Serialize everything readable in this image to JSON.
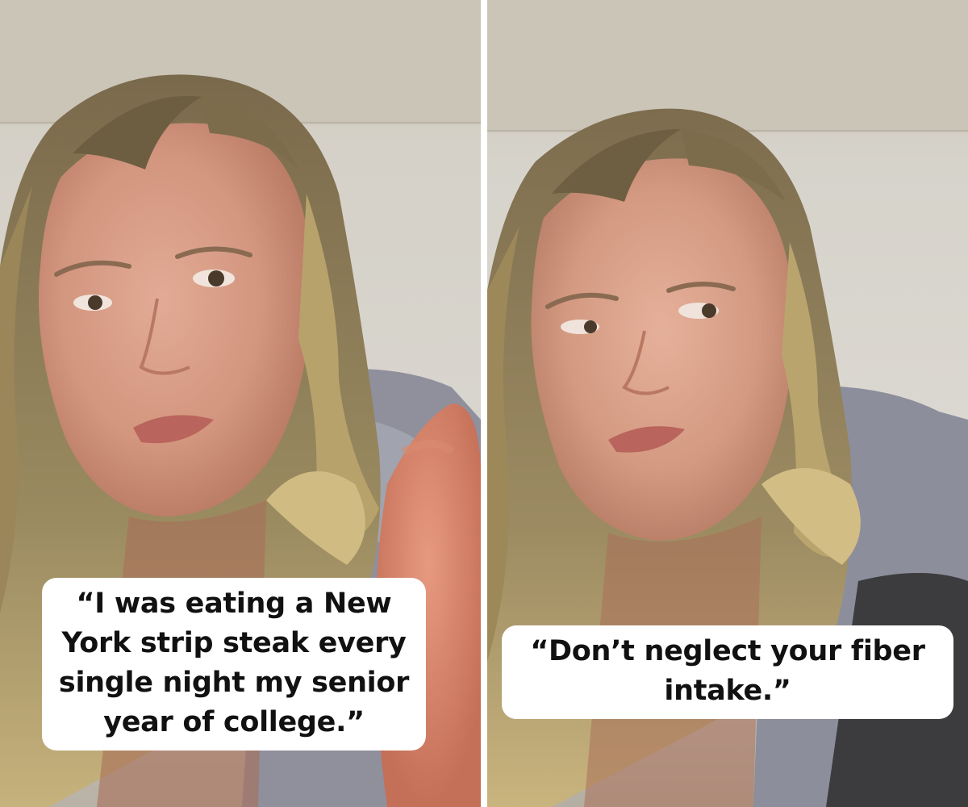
{
  "captions": {
    "left": "“I was eating a New York strip steak every single night my senior year of college.”",
    "right": "“Don’t neglect your fiber intake.”"
  },
  "colors": {
    "background": "#ffffff",
    "caption_bg": "#ffffff",
    "caption_text": "#111111",
    "wall": "#d8d4cc",
    "ceiling": "#c9c3b6",
    "hair": "#8a7a58",
    "skin": "#d9a08a",
    "hoodie": "#8b8d9a"
  }
}
